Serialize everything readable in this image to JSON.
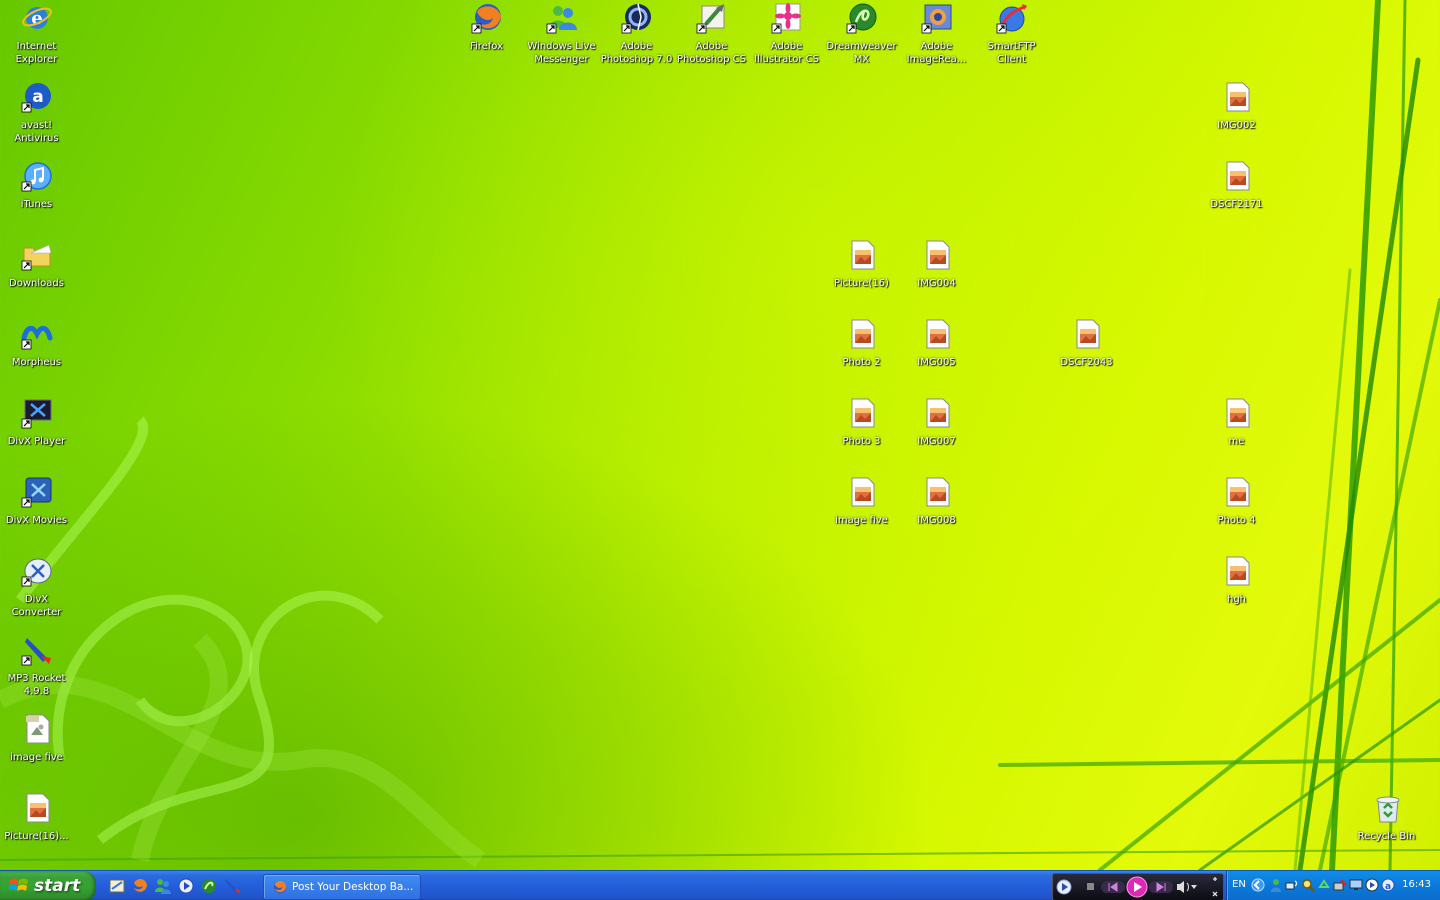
{
  "desktop": {
    "icons": {
      "ie": "Internet Explorer",
      "avast": "avast! Antivirus",
      "itunes": "iTunes",
      "downloads": "Downloads",
      "morpheus": "Morpheus",
      "divx_player": "DivX Player",
      "divx_movies": "DivX Movies",
      "divx_converter": "DivX Converter",
      "mp3rocket": "MP3 Rocket 4.9.8",
      "image_five_tiff": "image five",
      "picture16_left": "Picture(16)...",
      "firefox": "Firefox",
      "wlm": "Windows Live Messenger",
      "ps7": "Adobe Photoshop 7.0",
      "pscs": "Adobe Photoshop CS",
      "aics": "Adobe Illustrator CS",
      "dwmx": "Dreamweaver MX",
      "imageready": "Adobe ImageRea...",
      "smartftp": "SmartFTP Client",
      "img002": "IMG002",
      "dscf2171": "DSCF2171",
      "picture16": "Picture(16)",
      "img004": "IMG004",
      "photo2": "Photo 2",
      "img005": "IMG005",
      "dscf2043": "DSCF2043",
      "photo3": "Photo 3",
      "img007": "IMG007",
      "me": "me",
      "image_five": "image five",
      "img008": "IMG008",
      "photo4": "Photo 4",
      "hgh": "hgh",
      "recycle": "Recycle Bin"
    }
  },
  "taskbar": {
    "start_label": "start",
    "task_label": "Post Your Desktop Ba...",
    "language": "EN",
    "clock": "16:43"
  },
  "colors": {
    "taskbar_blue": "#245edb",
    "start_green": "#35a232",
    "tray_blue": "#0c79d9",
    "wallpaper_green": "#88db00",
    "wallpaper_yellow": "#e3fa0a"
  }
}
